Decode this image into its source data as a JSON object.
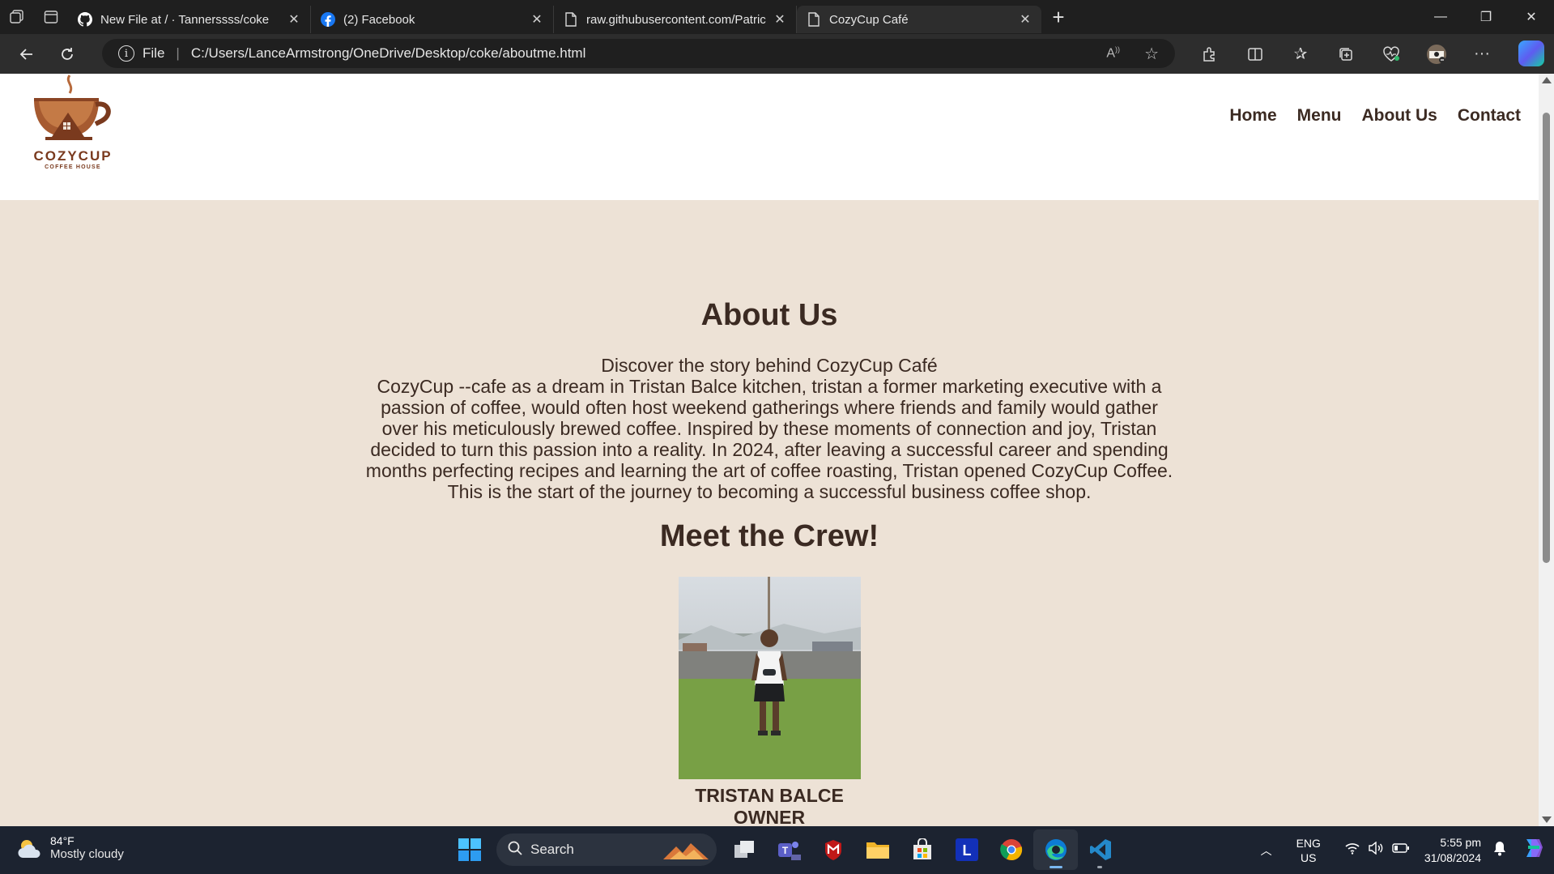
{
  "browser": {
    "tabs": [
      {
        "title": "New File at / · Tannerssss/coke",
        "favicon": "github-icon",
        "active": false
      },
      {
        "title": "(2) Facebook",
        "favicon": "facebook-icon",
        "active": false
      },
      {
        "title": "raw.githubusercontent.com/Patric",
        "favicon": "file-icon",
        "active": false
      },
      {
        "title": "CozyCup Café",
        "favicon": "file-icon",
        "active": true
      }
    ],
    "address": {
      "scheme_label": "File",
      "url": "C:/Users/LanceArmstrong/OneDrive/Desktop/coke/aboutme.html"
    }
  },
  "site": {
    "logo": {
      "title": "COZYCUP",
      "subtitle": "COFFEE HOUSE"
    },
    "nav": [
      "Home",
      "Menu",
      "About Us",
      "Contact"
    ],
    "about": {
      "title": "About Us",
      "intro": "Discover the story behind CozyCup Café",
      "story": "CozyCup --cafe as a dream in Tristan Balce kitchen, tristan a former marketing executive with a passion of coffee, would often host weekend gatherings where friends and family would gather over his meticulously brewed coffee. Inspired by these moments of connection and joy, Tristan decided to turn this passion into a reality. In 2024, after leaving a successful career and spending months perfecting recipes and learning the art of coffee roasting, Tristan opened CozyCup Coffee. This is the start of the journey to becoming a successful business coffee shop."
    },
    "crew": {
      "title": "Meet the Crew!",
      "members": [
        {
          "name": "TRISTAN BALCE",
          "role": "OWNER"
        }
      ]
    }
  },
  "taskbar": {
    "weather": {
      "temp": "84°F",
      "condition": "Mostly cloudy"
    },
    "search_label": "Search",
    "language": {
      "lang": "ENG",
      "region": "US"
    },
    "clock": {
      "time": "5:55 pm",
      "date": "31/08/2024"
    }
  },
  "colors": {
    "page_bg": "#ede2d6",
    "text_brown": "#3b2a22",
    "logo_brown": "#7a3a1e",
    "browser_dark": "#1f1f1f",
    "taskbar": "#1c2330"
  }
}
